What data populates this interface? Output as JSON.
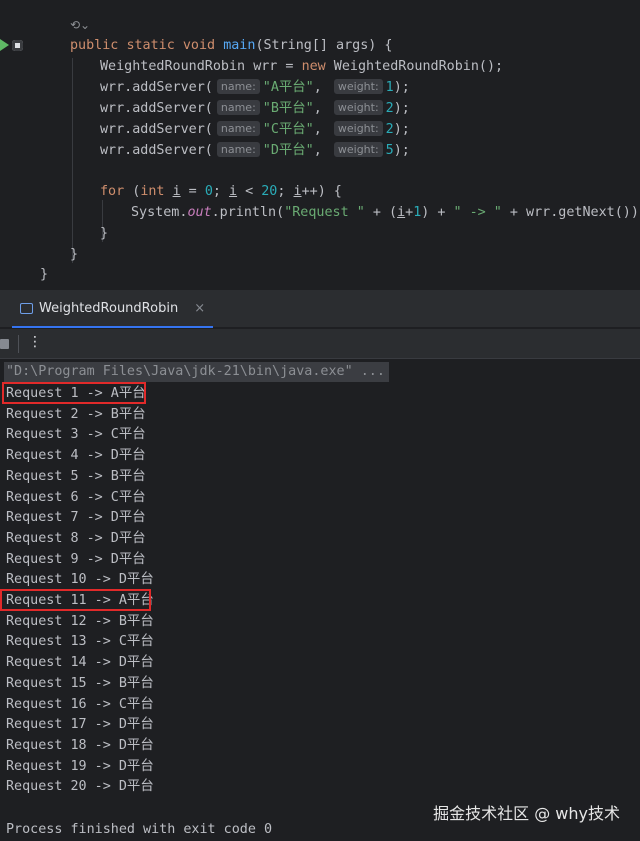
{
  "editor": {
    "lines": [
      {
        "key": "sig"
      },
      {
        "key": "wrr"
      },
      {
        "key": "add1"
      },
      {
        "key": "add2"
      },
      {
        "key": "add3"
      },
      {
        "key": "add4"
      }
    ],
    "signature": {
      "public": "public",
      "static": "static",
      "void": "void",
      "name": "main",
      "params": "(String[] args) {"
    },
    "decl": {
      "type": "WeightedRoundRobin",
      "var": "wrr",
      "eq": " = ",
      "new": "new",
      "ctor": " WeightedRoundRobin();"
    },
    "servers": [
      {
        "call": "wrr.addServer(",
        "name_hint": "name:",
        "name": "\"A平台\"",
        "weight_hint": "weight:",
        "weight": "1"
      },
      {
        "call": "wrr.addServer(",
        "name_hint": "name:",
        "name": "\"B平台\"",
        "weight_hint": "weight:",
        "weight": "2"
      },
      {
        "call": "wrr.addServer(",
        "name_hint": "name:",
        "name": "\"C平台\"",
        "weight_hint": "weight:",
        "weight": "2"
      },
      {
        "call": "wrr.addServer(",
        "name_hint": "name:",
        "name": "\"D平台\"",
        "weight_hint": "weight:",
        "weight": "5"
      }
    ],
    "forloop": {
      "for": "for",
      "open": " (",
      "int": "int",
      "i": "i",
      "eq": " = ",
      "zero": "0",
      "semi": "; ",
      "lt": " < ",
      "twenty": "20",
      "inc": "++",
      "close": ") {"
    },
    "println": {
      "sys": "System.",
      "out": "out",
      "rest1": ".println(",
      "str1": "\"Request \"",
      "plus1": " + (",
      "one": "1",
      "plus2": ") + ",
      "str2": "\" -> \"",
      "rest2": " + wrr.getNext());"
    },
    "brace": "}",
    "semi_close": ");",
    "comma": ", "
  },
  "run_window": {
    "tab_label": "WeightedRoundRobin",
    "tab_close": "×",
    "more": "⋮"
  },
  "console": {
    "command": "\"D:\\Program Files\\Java\\jdk-21\\bin\\java.exe\" ...",
    "lines": [
      "Request 1 -> A平台",
      "Request 2 -> B平台",
      "Request 3 -> C平台",
      "Request 4 -> D平台",
      "Request 5 -> B平台",
      "Request 6 -> C平台",
      "Request 7 -> D平台",
      "Request 8 -> D平台",
      "Request 9 -> D平台",
      "Request 10 -> D平台",
      "Request 11 -> A平台",
      "Request 12 -> B平台",
      "Request 13 -> C平台",
      "Request 14 -> D平台",
      "Request 15 -> B平台",
      "Request 16 -> C平台",
      "Request 17 -> D平台",
      "Request 18 -> D平台",
      "Request 19 -> D平台",
      "Request 20 -> D平台"
    ],
    "exit": "Process finished with exit code 0"
  },
  "watermark": "掘金技术社区 @ why技术",
  "colors": {
    "highlight": "#e12a2a",
    "keyword": "#cf8e6d",
    "string": "#6aab73",
    "number": "#2aacb8",
    "function": "#56a8f5"
  }
}
